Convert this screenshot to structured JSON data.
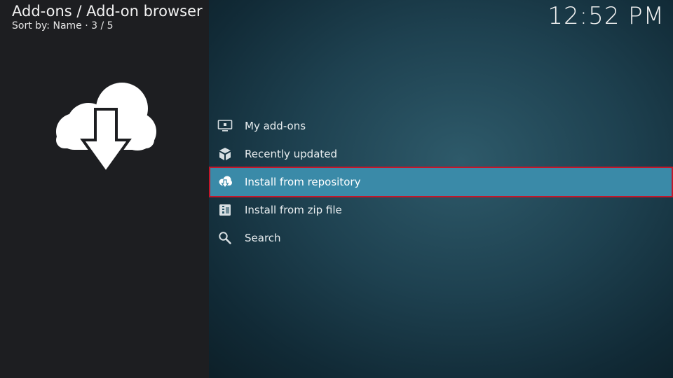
{
  "header": {
    "title": "Add-ons / Add-on browser",
    "subtitle": "Sort by: Name  ·  3 / 5"
  },
  "clock": "12:52 PM",
  "preview": {
    "icon": "cloud-download-icon"
  },
  "menu": {
    "items": [
      {
        "label": "My add-ons",
        "icon": "monitor-icon",
        "selected": false
      },
      {
        "label": "Recently updated",
        "icon": "open-box-icon",
        "selected": false
      },
      {
        "label": "Install from repository",
        "icon": "cloud-download-icon",
        "selected": true
      },
      {
        "label": "Install from zip file",
        "icon": "zip-file-icon",
        "selected": false
      },
      {
        "label": "Search",
        "icon": "search-icon",
        "selected": false
      }
    ]
  },
  "colors": {
    "selected_bg": "#3a8aa8",
    "selected_border": "#c4162a",
    "left_panel": "#1d1e21"
  }
}
